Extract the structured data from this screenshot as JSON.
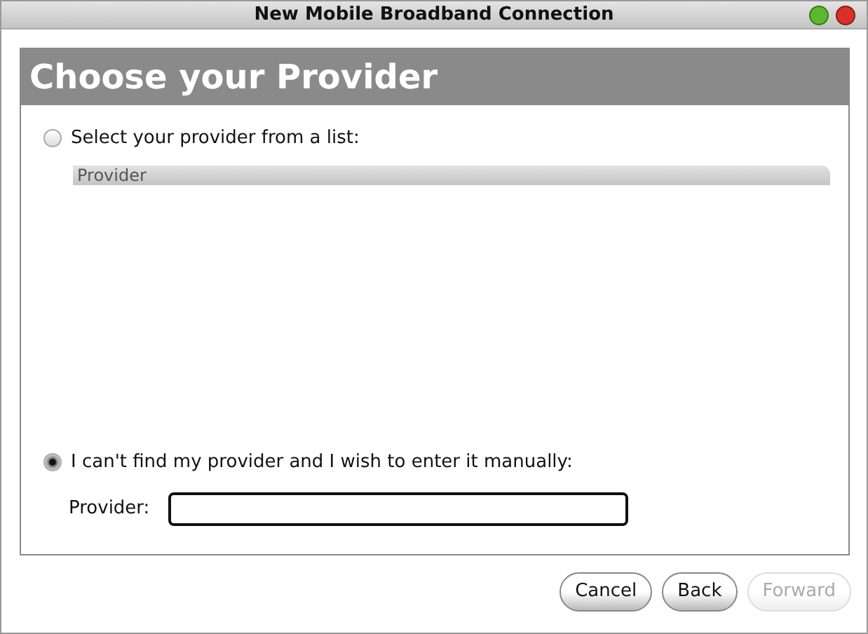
{
  "window": {
    "title": "New Mobile Broadband Connection"
  },
  "header": {
    "title": "Choose your Provider"
  },
  "options": [
    {
      "label": "Select your provider from a list:",
      "selected": false
    },
    {
      "label": "I can't find my provider and I wish to enter it manually:",
      "selected": true
    }
  ],
  "provider_list": {
    "column": "Provider"
  },
  "provider_field": {
    "label": "Provider:"
  },
  "buttons": [
    {
      "label": "Cancel",
      "disabled": false
    },
    {
      "label": "Back",
      "disabled": false
    },
    {
      "label": "Forward",
      "disabled": true
    }
  ]
}
